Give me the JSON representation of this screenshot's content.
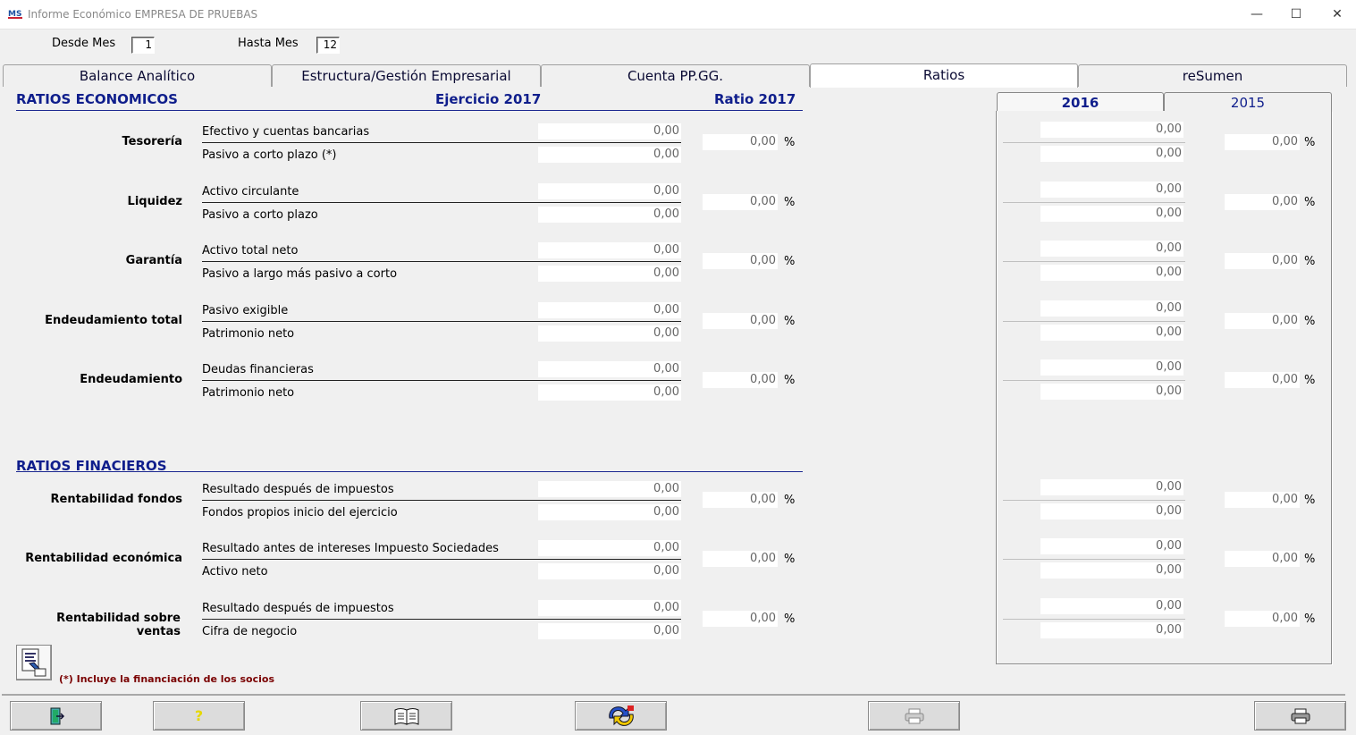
{
  "window": {
    "title": "Informe Económico EMPRESA DE PRUEBAS",
    "controls": {
      "minimize": "—",
      "maximize": "☐",
      "close": "✕"
    }
  },
  "filters": {
    "desde_label": "Desde Mes",
    "desde_value": "1",
    "hasta_label": "Hasta Mes",
    "hasta_value": "12"
  },
  "tabs": [
    {
      "label": "Balance Analítico",
      "active": false
    },
    {
      "label": "Estructura/Gestión Empresarial",
      "active": false
    },
    {
      "label": "Cuenta PP.GG.",
      "active": false
    },
    {
      "label": "Ratios",
      "active": true
    },
    {
      "label": "reSumen",
      "active": false
    }
  ],
  "section_economic": {
    "title": "RATIOS ECONOMICOS",
    "col_year": "Ejercicio 2017",
    "col_ratio": "Ratio 2017"
  },
  "section_financial": {
    "title": "RATIOS FINACIEROS"
  },
  "ratios": [
    {
      "name": "Tesorería",
      "num_label": "Efectivo y cuentas bancarias",
      "num_value": "0,00",
      "den_label": "Pasivo a corto plazo (*)",
      "den_value": "0,00",
      "ratio": "0,00",
      "pct": "%",
      "y2016_num": "0,00",
      "y2016_den": "0,00",
      "y2016_ratio": "0,00"
    },
    {
      "name": "Liquidez",
      "num_label": "Activo circulante",
      "num_value": "0,00",
      "den_label": "Pasivo a corto plazo",
      "den_value": "0,00",
      "ratio": "0,00",
      "pct": "%",
      "y2016_num": "0,00",
      "y2016_den": "0,00",
      "y2016_ratio": "0,00"
    },
    {
      "name": "Garantía",
      "num_label": "Activo total neto",
      "num_value": "0,00",
      "den_label": "Pasivo a largo más pasivo a corto",
      "den_value": "0,00",
      "ratio": "0,00",
      "pct": "%",
      "y2016_num": "0,00",
      "y2016_den": "0,00",
      "y2016_ratio": "0,00"
    },
    {
      "name": "Endeudamiento total",
      "num_label": "Pasivo exigible",
      "num_value": "0,00",
      "den_label": "Patrimonio neto",
      "den_value": "0,00",
      "ratio": "0,00",
      "pct": "%",
      "y2016_num": "0,00",
      "y2016_den": "0,00",
      "y2016_ratio": "0,00"
    },
    {
      "name": "Endeudamiento",
      "num_label": "Deudas financieras",
      "num_value": "0,00",
      "den_label": "Patrimonio neto",
      "den_value": "0,00",
      "ratio": "0,00",
      "pct": "%",
      "y2016_num": "0,00",
      "y2016_den": "0,00",
      "y2016_ratio": "0,00"
    },
    {
      "name": "Rentabilidad fondos",
      "num_label": "Resultado después de impuestos",
      "num_value": "0,00",
      "den_label": "Fondos propios inicio del ejercicio",
      "den_value": "0,00",
      "ratio": "0,00",
      "pct": "%",
      "y2016_num": "0,00",
      "y2016_den": "0,00",
      "y2016_ratio": "0,00"
    },
    {
      "name": "Rentabilidad económica",
      "num_label": "Resultado antes de intereses Impuesto Sociedades",
      "num_value": "0,00",
      "den_label": "Activo neto",
      "den_value": "0,00",
      "ratio": "0,00",
      "pct": "%",
      "y2016_num": "0,00",
      "y2016_den": "0,00",
      "y2016_ratio": "0,00"
    },
    {
      "name": "Rentabilidad sobre ventas",
      "num_label": "Resultado después de impuestos",
      "num_value": "0,00",
      "den_label": "Cifra de negocio",
      "den_value": "0,00",
      "ratio": "0,00",
      "pct": "%",
      "y2016_num": "0,00",
      "y2016_den": "0,00",
      "y2016_ratio": "0,00"
    }
  ],
  "year_tabs": [
    {
      "label": "2016",
      "active": true
    },
    {
      "label": "2015",
      "active": false
    }
  ],
  "footnote": "(*) Incluye la financiación de los socios",
  "bottom_buttons": [
    {
      "icon": "exit-icon",
      "glyph": "🚪"
    },
    {
      "icon": "help-icon",
      "glyph": "?"
    },
    {
      "icon": "book-icon",
      "glyph": "📖"
    },
    {
      "icon": "refresh-icon",
      "glyph": "⇆"
    },
    {
      "icon": "printer-light-icon",
      "glyph": "🖶"
    },
    {
      "icon": "printer-icon",
      "glyph": "🖶"
    }
  ],
  "colors": {
    "header_blue": "#0f1e8c",
    "footnote_red": "#7a0000"
  }
}
